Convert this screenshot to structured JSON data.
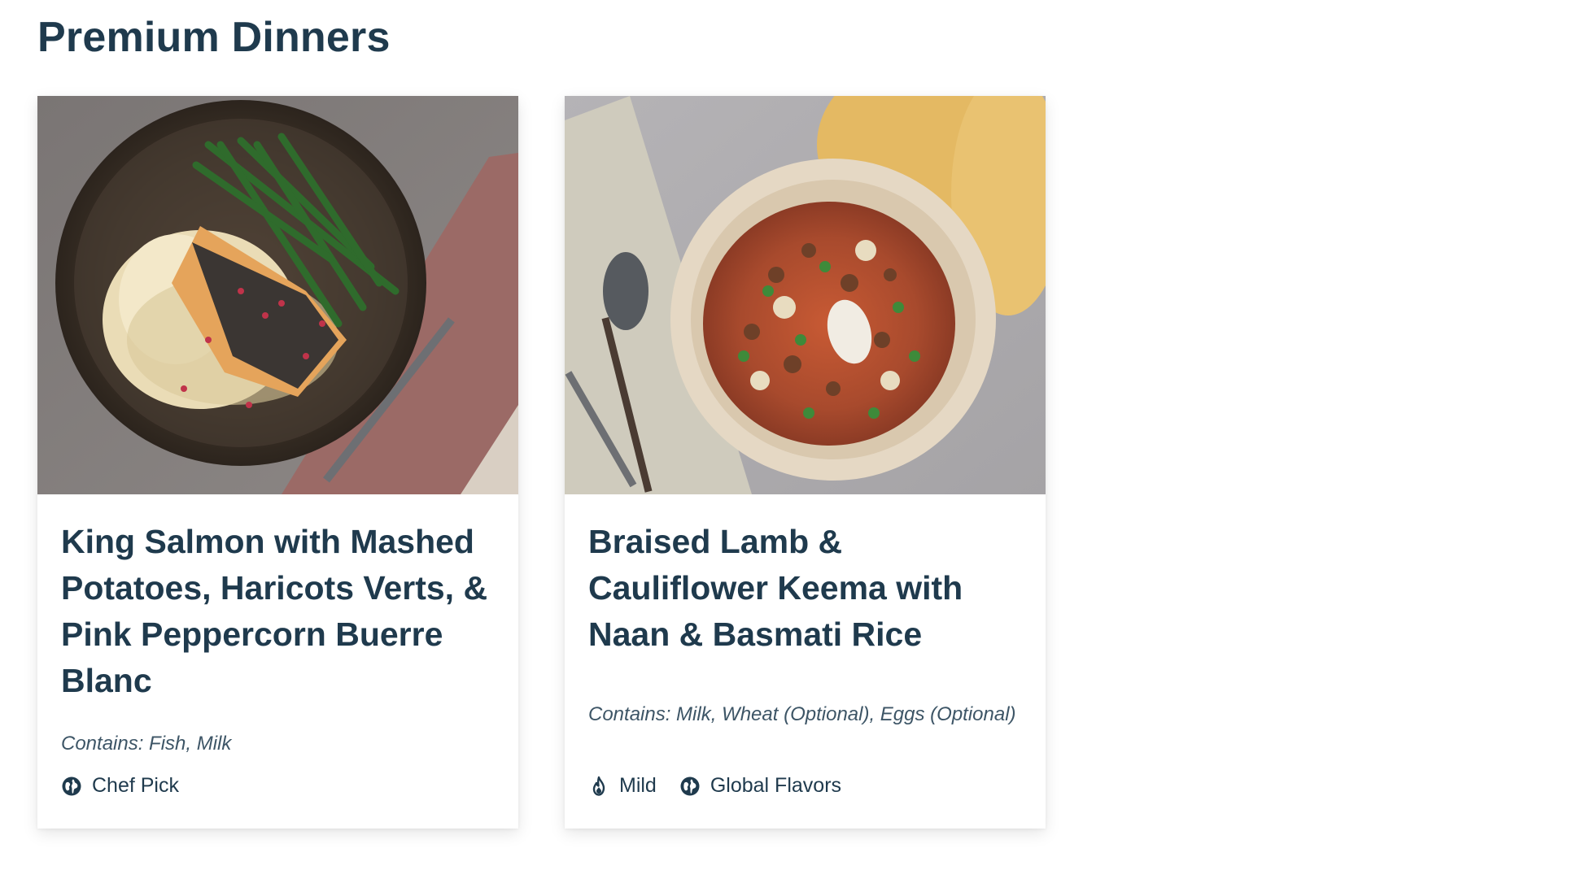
{
  "section": {
    "title": "Premium Dinners"
  },
  "cards": [
    {
      "title": "King Salmon with Mashed Potatoes, Haricots Verts, & Pink Peppercorn Buerre Blanc",
      "allergens": "Contains: Fish, Milk",
      "image_icon": "salmon-dish-photo",
      "tags": [
        {
          "icon": "globe-icon",
          "label": "Chef Pick"
        }
      ]
    },
    {
      "title": "Braised Lamb & Cauliflower Keema with Naan & Basmati Rice",
      "allergens": "Contains: Milk, Wheat (Optional), Eggs (Optional)",
      "image_icon": "keema-dish-photo",
      "tags": [
        {
          "icon": "flame-icon",
          "label": "Mild"
        },
        {
          "icon": "globe-icon",
          "label": "Global Flavors"
        }
      ]
    }
  ],
  "colors": {
    "text": "#1f3a4d",
    "muted": "#3d5566",
    "card_bg": "#ffffff"
  }
}
